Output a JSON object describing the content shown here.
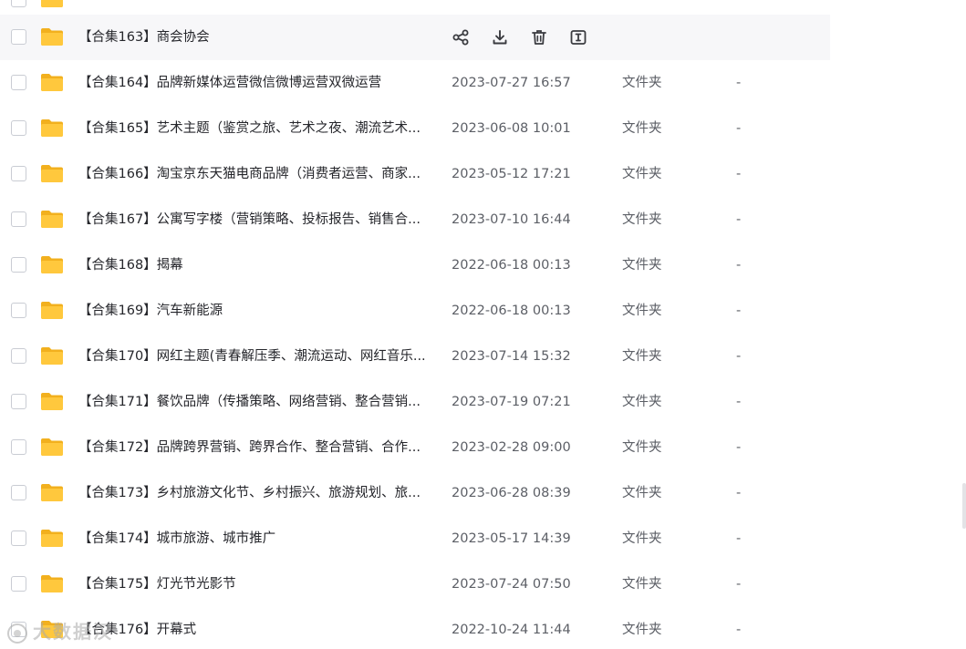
{
  "rows": [
    {
      "name": "【合集163】商会协会",
      "date": "",
      "type": "",
      "size": "",
      "hover": true
    },
    {
      "name": "【合集164】品牌新媒体运营微信微博运营双微运营",
      "date": "2023-07-27 16:57",
      "type": "文件夹",
      "size": "-"
    },
    {
      "name": "【合集165】艺术主题（鉴赏之旅、艺术之夜、潮流艺术...",
      "date": "2023-06-08 10:01",
      "type": "文件夹",
      "size": "-"
    },
    {
      "name": "【合集166】淘宝京东天猫电商品牌（消费者运营、商家...",
      "date": "2023-05-12 17:21",
      "type": "文件夹",
      "size": "-"
    },
    {
      "name": "【合集167】公寓写字楼（营销策略、投标报告、销售合...",
      "date": "2023-07-10 16:44",
      "type": "文件夹",
      "size": "-"
    },
    {
      "name": "【合集168】揭幕",
      "date": "2022-06-18 00:13",
      "type": "文件夹",
      "size": "-"
    },
    {
      "name": "【合集169】汽车新能源",
      "date": "2022-06-18 00:13",
      "type": "文件夹",
      "size": "-"
    },
    {
      "name": "【合集170】网红主题(青春解压季、潮流运动、网红音乐...",
      "date": "2023-07-14 15:32",
      "type": "文件夹",
      "size": "-"
    },
    {
      "name": "【合集171】餐饮品牌（传播策略、网络营销、整合营销...",
      "date": "2023-07-19 07:21",
      "type": "文件夹",
      "size": "-"
    },
    {
      "name": "【合集172】品牌跨界营销、跨界合作、整合营销、合作...",
      "date": "2023-02-28 09:00",
      "type": "文件夹",
      "size": "-"
    },
    {
      "name": "【合集173】乡村旅游文化节、乡村振兴、旅游规划、旅...",
      "date": "2023-06-28 08:39",
      "type": "文件夹",
      "size": "-"
    },
    {
      "name": "【合集174】城市旅游、城市推广",
      "date": "2023-05-17 14:39",
      "type": "文件夹",
      "size": "-"
    },
    {
      "name": "【合集175】灯光节光影节",
      "date": "2023-07-24 07:50",
      "type": "文件夹",
      "size": "-"
    },
    {
      "name": "【合集176】开幕式",
      "date": "2022-10-24 11:44",
      "type": "文件夹",
      "size": "-"
    }
  ],
  "hover_actions": [
    "share-icon",
    "download-icon",
    "delete-icon",
    "rename-icon"
  ],
  "watermark": "大数据汉",
  "colors": {
    "folder": "#ffc83d",
    "folder_tab": "#f2b01e",
    "hover_row": "#f7f7f9",
    "icon": "#3a3b40"
  }
}
